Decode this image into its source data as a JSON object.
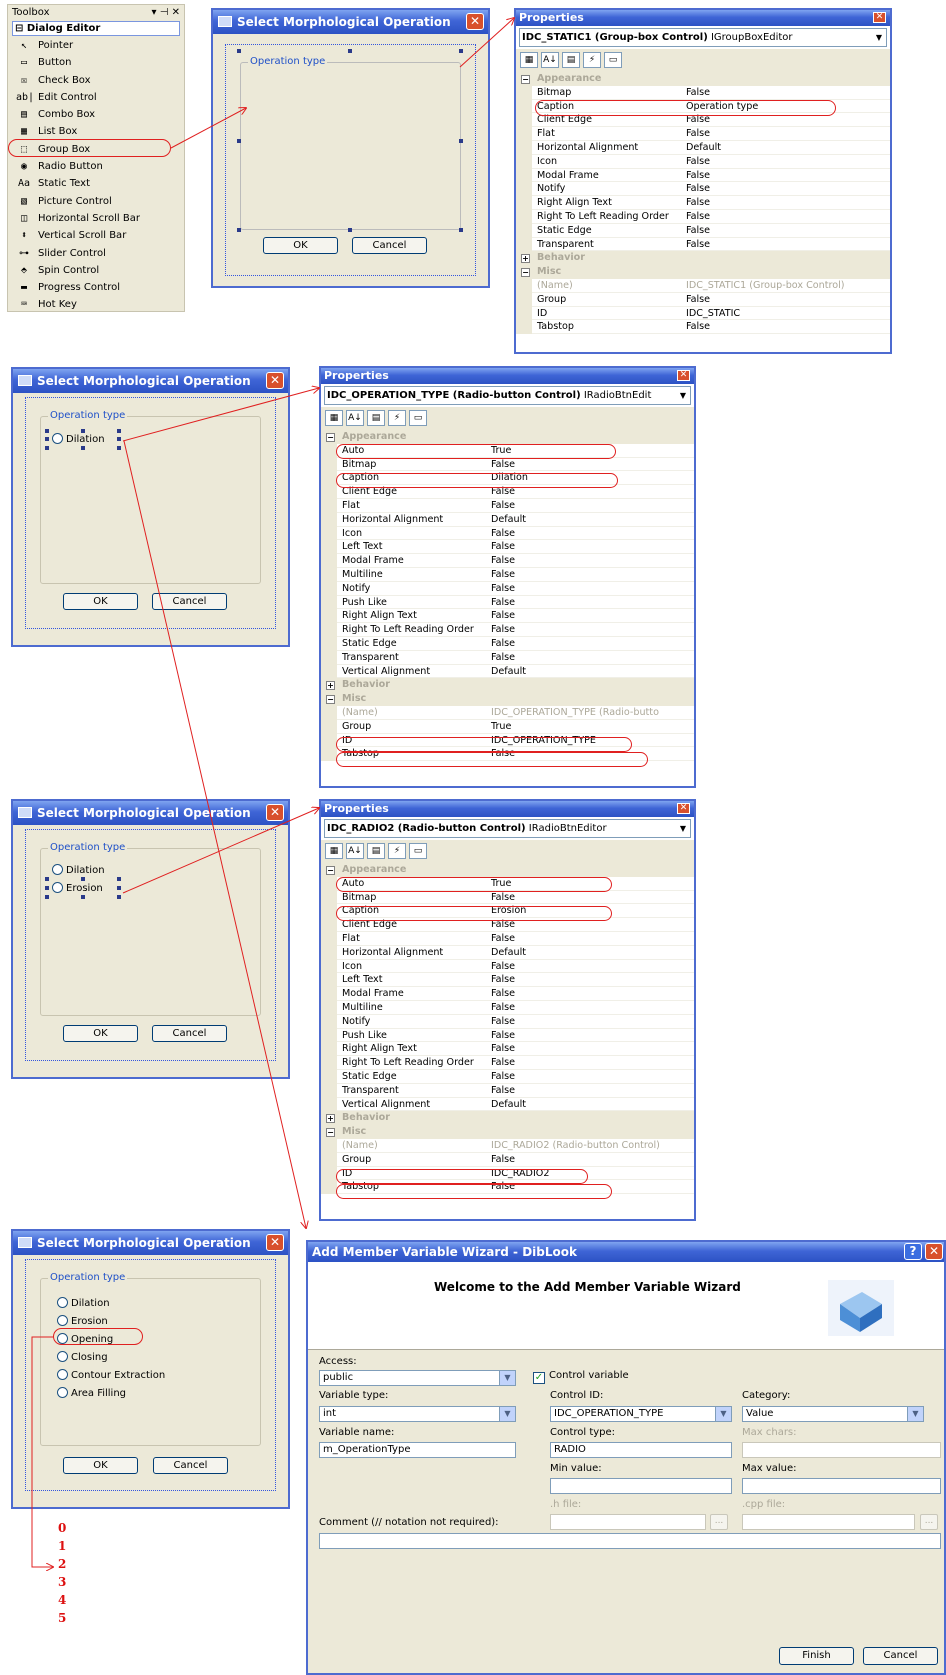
{
  "toolbox": {
    "title": "Toolbox",
    "controls": "▾ ⊣ ✕",
    "section": "Dialog Editor",
    "items": [
      {
        "label": "Pointer",
        "icon": "pointer-icon",
        "glyph": "↖"
      },
      {
        "label": "Button",
        "icon": "button-icon",
        "glyph": "▭"
      },
      {
        "label": "Check Box",
        "icon": "checkbox-icon",
        "glyph": "☒"
      },
      {
        "label": "Edit Control",
        "icon": "edit-control-icon",
        "glyph": "ab|"
      },
      {
        "label": "Combo Box",
        "icon": "combobox-icon",
        "glyph": "▤"
      },
      {
        "label": "List Box",
        "icon": "listbox-icon",
        "glyph": "▦"
      },
      {
        "label": "Group Box",
        "icon": "groupbox-icon",
        "glyph": "⬚"
      },
      {
        "label": "Radio Button",
        "icon": "radio-button-icon",
        "glyph": "◉"
      },
      {
        "label": "Static Text",
        "icon": "static-text-icon",
        "glyph": "Aa"
      },
      {
        "label": "Picture Control",
        "icon": "picture-control-icon",
        "glyph": "▧"
      },
      {
        "label": "Horizontal Scroll Bar",
        "icon": "hscroll-icon",
        "glyph": "◫"
      },
      {
        "label": "Vertical Scroll Bar",
        "icon": "vscroll-icon",
        "glyph": "⬍"
      },
      {
        "label": "Slider Control",
        "icon": "slider-icon",
        "glyph": "⊶"
      },
      {
        "label": "Spin Control",
        "icon": "spin-icon",
        "glyph": "⬘"
      },
      {
        "label": "Progress Control",
        "icon": "progress-icon",
        "glyph": "▬"
      },
      {
        "label": "Hot Key",
        "icon": "hotkey-icon",
        "glyph": "⌨"
      }
    ]
  },
  "dialog": {
    "title": "Select Morphological Operation",
    "group_label": "Operation type",
    "ok": "OK",
    "cancel": "Cancel",
    "close": "✕"
  },
  "radios": [
    "Dilation",
    "Erosion",
    "Opening",
    "Closing",
    "Contour Extraction",
    "Area Filling"
  ],
  "numbers": [
    "0",
    "1",
    "2",
    "3",
    "4",
    "5"
  ],
  "props1": {
    "title": "Properties",
    "combo_bold": "IDC_STATIC1 (Group-box Control)",
    "combo_rest": " IGroupBoxEditor",
    "cat_appearance": "Appearance",
    "cat_behavior": "Behavior",
    "cat_misc": "Misc",
    "appearance": [
      [
        "Bitmap",
        "False"
      ],
      [
        "Caption",
        "Operation type"
      ],
      [
        "Client Edge",
        "False"
      ],
      [
        "Flat",
        "False"
      ],
      [
        "Horizontal Alignment",
        "Default"
      ],
      [
        "Icon",
        "False"
      ],
      [
        "Modal Frame",
        "False"
      ],
      [
        "Notify",
        "False"
      ],
      [
        "Right Align Text",
        "False"
      ],
      [
        "Right To Left Reading Order",
        "False"
      ],
      [
        "Static Edge",
        "False"
      ],
      [
        "Transparent",
        "False"
      ]
    ],
    "misc": [
      [
        "(Name)",
        "IDC_STATIC1 (Group-box Control)"
      ],
      [
        "Group",
        "False"
      ],
      [
        "ID",
        "IDC_STATIC"
      ],
      [
        "Tabstop",
        "False"
      ]
    ]
  },
  "props2": {
    "title": "Properties",
    "combo_bold": "IDC_OPERATION_TYPE (Radio-button Control)",
    "combo_rest": " IRadioBtnEdit",
    "cat_appearance": "Appearance",
    "cat_behavior": "Behavior",
    "cat_misc": "Misc",
    "appearance": [
      [
        "Auto",
        "True"
      ],
      [
        "Bitmap",
        "False"
      ],
      [
        "Caption",
        "Dilation"
      ],
      [
        "Client Edge",
        "False"
      ],
      [
        "Flat",
        "False"
      ],
      [
        "Horizontal Alignment",
        "Default"
      ],
      [
        "Icon",
        "False"
      ],
      [
        "Left Text",
        "False"
      ],
      [
        "Modal Frame",
        "False"
      ],
      [
        "Multiline",
        "False"
      ],
      [
        "Notify",
        "False"
      ],
      [
        "Push Like",
        "False"
      ],
      [
        "Right Align Text",
        "False"
      ],
      [
        "Right To Left Reading Order",
        "False"
      ],
      [
        "Static Edge",
        "False"
      ],
      [
        "Transparent",
        "False"
      ],
      [
        "Vertical Alignment",
        "Default"
      ]
    ],
    "misc": [
      [
        "(Name)",
        "IDC_OPERATION_TYPE (Radio-butto"
      ],
      [
        "Group",
        "True"
      ],
      [
        "ID",
        "IDC_OPERATION_TYPE"
      ],
      [
        "Tabstop",
        "False"
      ]
    ]
  },
  "props3": {
    "title": "Properties",
    "combo_bold": "IDC_RADIO2 (Radio-button Control)",
    "combo_rest": " IRadioBtnEditor",
    "cat_appearance": "Appearance",
    "cat_behavior": "Behavior",
    "cat_misc": "Misc",
    "appearance": [
      [
        "Auto",
        "True"
      ],
      [
        "Bitmap",
        "False"
      ],
      [
        "Caption",
        "Erosion"
      ],
      [
        "Client Edge",
        "False"
      ],
      [
        "Flat",
        "False"
      ],
      [
        "Horizontal Alignment",
        "Default"
      ],
      [
        "Icon",
        "False"
      ],
      [
        "Left Text",
        "False"
      ],
      [
        "Modal Frame",
        "False"
      ],
      [
        "Multiline",
        "False"
      ],
      [
        "Notify",
        "False"
      ],
      [
        "Push Like",
        "False"
      ],
      [
        "Right Align Text",
        "False"
      ],
      [
        "Right To Left Reading Order",
        "False"
      ],
      [
        "Static Edge",
        "False"
      ],
      [
        "Transparent",
        "False"
      ],
      [
        "Vertical Alignment",
        "Default"
      ]
    ],
    "misc": [
      [
        "(Name)",
        "IDC_RADIO2 (Radio-button Control)"
      ],
      [
        "Group",
        "False"
      ],
      [
        "ID",
        "IDC_RADIO2"
      ],
      [
        "Tabstop",
        "False"
      ]
    ]
  },
  "wizard": {
    "title": "Add Member Variable Wizard - DibLook",
    "heading": "Welcome to the Add Member Variable Wizard",
    "access_label": "Access:",
    "access_value": "public",
    "control_variable": "Control variable",
    "variable_type_label": "Variable type:",
    "variable_type_value": "int",
    "control_id_label": "Control ID:",
    "control_id_value": "IDC_OPERATION_TYPE",
    "category_label": "Category:",
    "category_value": "Value",
    "variable_name_label": "Variable name:",
    "variable_name_value": "m_OperationType",
    "control_type_label": "Control type:",
    "control_type_value": "RADIO",
    "max_chars_label": "Max chars:",
    "min_value_label": "Min value:",
    "max_value_label": "Max value:",
    "h_file_label": ".h file:",
    "cpp_file_label": ".cpp file:",
    "comment_label": "Comment (// notation not required):",
    "browse": "...",
    "finish": "Finish",
    "cancel": "Cancel",
    "help": "?",
    "close": "✕"
  },
  "colors": {
    "annotation": "#e02020",
    "title_bar": "#2c52c4",
    "dialog_bg": "#ece9d8"
  }
}
